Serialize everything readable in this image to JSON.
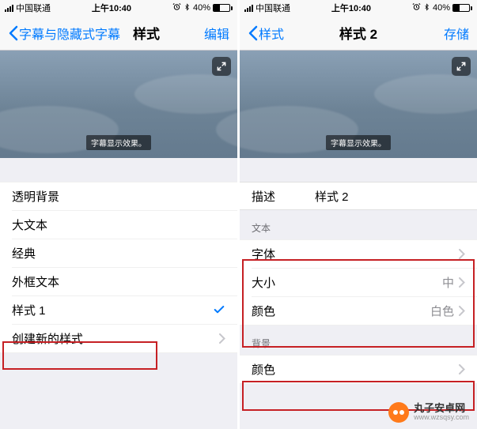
{
  "status": {
    "carrier": "中国联通",
    "time": "上午10:40",
    "battery_pct": "40%",
    "icons": [
      "signal",
      "alarm",
      "bluetooth",
      "battery"
    ]
  },
  "left": {
    "nav": {
      "back": "字幕与隐藏式字幕",
      "title": "样式",
      "action": "编辑"
    },
    "preview_subtitle": "字幕显示效果。",
    "styles": [
      {
        "label": "透明背景"
      },
      {
        "label": "大文本"
      },
      {
        "label": "经典"
      },
      {
        "label": "外框文本"
      },
      {
        "label": "样式 1",
        "selected": true
      }
    ],
    "create_new": "创建新的样式..."
  },
  "right": {
    "nav": {
      "back": "样式",
      "title": "样式 2",
      "action": "存储"
    },
    "preview_subtitle": "字幕显示效果。",
    "description": {
      "label": "描述",
      "value": "样式 2"
    },
    "sections": {
      "text": {
        "header": "文本",
        "rows": [
          {
            "label": "字体",
            "value": ""
          },
          {
            "label": "大小",
            "value": "中"
          },
          {
            "label": "颜色",
            "value": "白色"
          }
        ]
      },
      "background": {
        "header": "背景",
        "rows": [
          {
            "label": "颜色",
            "value": ""
          }
        ]
      }
    }
  },
  "watermark": {
    "title": "丸子安卓网",
    "url": "www.wzsqsy.com"
  }
}
